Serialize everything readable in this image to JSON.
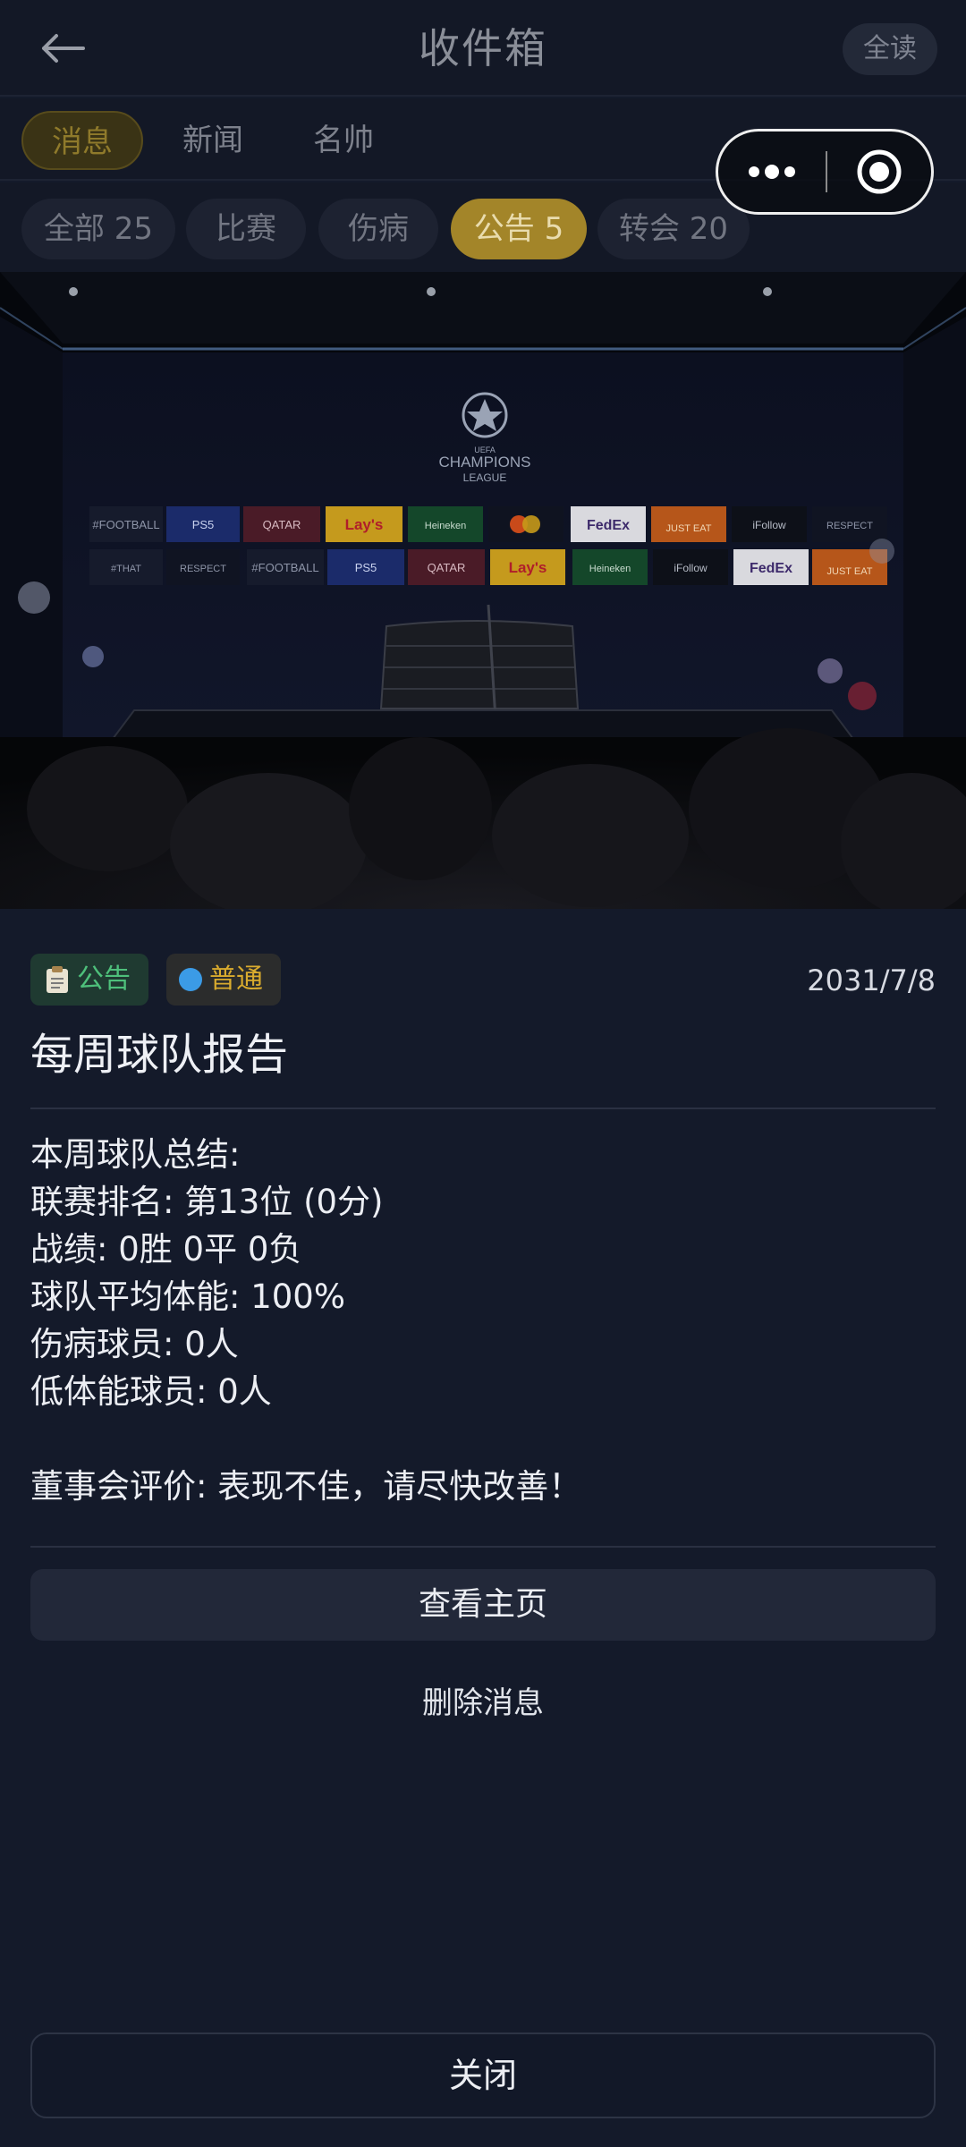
{
  "header": {
    "back_icon": "arrow-left-icon",
    "title": "收件箱",
    "read_all": "全读"
  },
  "categories": [
    {
      "label": "消息",
      "active": true
    },
    {
      "label": "新闻",
      "active": false
    },
    {
      "label": "名帅",
      "active": false
    }
  ],
  "filters": [
    {
      "label": "全部 25",
      "active": false
    },
    {
      "label": "比赛",
      "active": false
    },
    {
      "label": "伤病",
      "active": false
    },
    {
      "label": "公告 5",
      "active": true
    },
    {
      "label": "转会 20",
      "active": false
    }
  ],
  "capsule": {
    "more_icon": "more-dots-icon",
    "close_icon": "target-close-icon"
  },
  "banner": {
    "logo_text": "CHAMPIONS",
    "logo_sub": "LEAGUE",
    "logo_top": "UEFA",
    "sponsors_row1": [
      "#FOOTBALL",
      "PS5",
      "QATAR",
      "Lay's",
      "Heineken",
      "●●",
      "FedEx",
      "JUST EAT",
      "iFollow",
      "RESPECT"
    ],
    "sponsors_row2": [
      "#THAT",
      "RESPECT",
      "#FOOTBALL",
      "PS5",
      "QATAR",
      "Lay's",
      "Heineken",
      "iFollow",
      "FedEx",
      "JUST EAT"
    ]
  },
  "message": {
    "type_icon": "clipboard-icon",
    "type_label": "公告",
    "priority_label": "普通",
    "date": "2031/7/8",
    "title": "每周球队报告",
    "lines": [
      "本周球队总结:",
      "联赛排名: 第13位 (0分)",
      "战绩: 0胜 0平 0负",
      "球队平均体能: 100%",
      "伤病球员: 0人",
      "低体能球员: 0人",
      "",
      "董事会评价: 表现不佳，请尽快改善！"
    ]
  },
  "actions": {
    "view_home": "查看主页",
    "delete": "删除消息",
    "close": "关闭"
  }
}
